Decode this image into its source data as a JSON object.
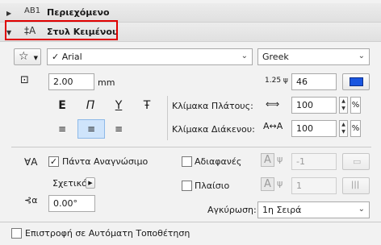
{
  "sections": {
    "content": {
      "title": "Περιεχόμενο",
      "icon_text": "AB1"
    },
    "text_style": {
      "title": "Στυλ Κειμένου"
    }
  },
  "font": {
    "name": "Arial",
    "script": "Greek"
  },
  "size": {
    "value": "2.00",
    "unit": "mm"
  },
  "rotation_style_value": "46",
  "style_buttons": {
    "bold": "E",
    "italic": "Π",
    "underline": "Y",
    "strike": "Ŧ"
  },
  "scales": {
    "width_label": "Κλίμακα Πλάτους:",
    "width_value": "100",
    "spacing_label": "Κλίμακα Διάκενου:",
    "spacing_value": "100",
    "percent": "%"
  },
  "options": {
    "always_readable": {
      "label": "Πάντα Αναγνώσιμο",
      "checked": true
    },
    "relative_label": "Σχετικό",
    "angle_value": "0.00°",
    "opaque": {
      "label": "Αδιαφανές",
      "checked": false,
      "value": "-1"
    },
    "frame": {
      "label": "Πλαίσιο",
      "checked": false,
      "value": "1"
    },
    "anchor_label": "Αγκύρωση:",
    "anchor_value": "1η Σειρά"
  },
  "footer": {
    "label": "Επιστροφή σε Αυτόματη Τοποθέτηση",
    "checked": false
  },
  "colors": {
    "accent": "#1a56e0",
    "highlight": "#e00000"
  }
}
